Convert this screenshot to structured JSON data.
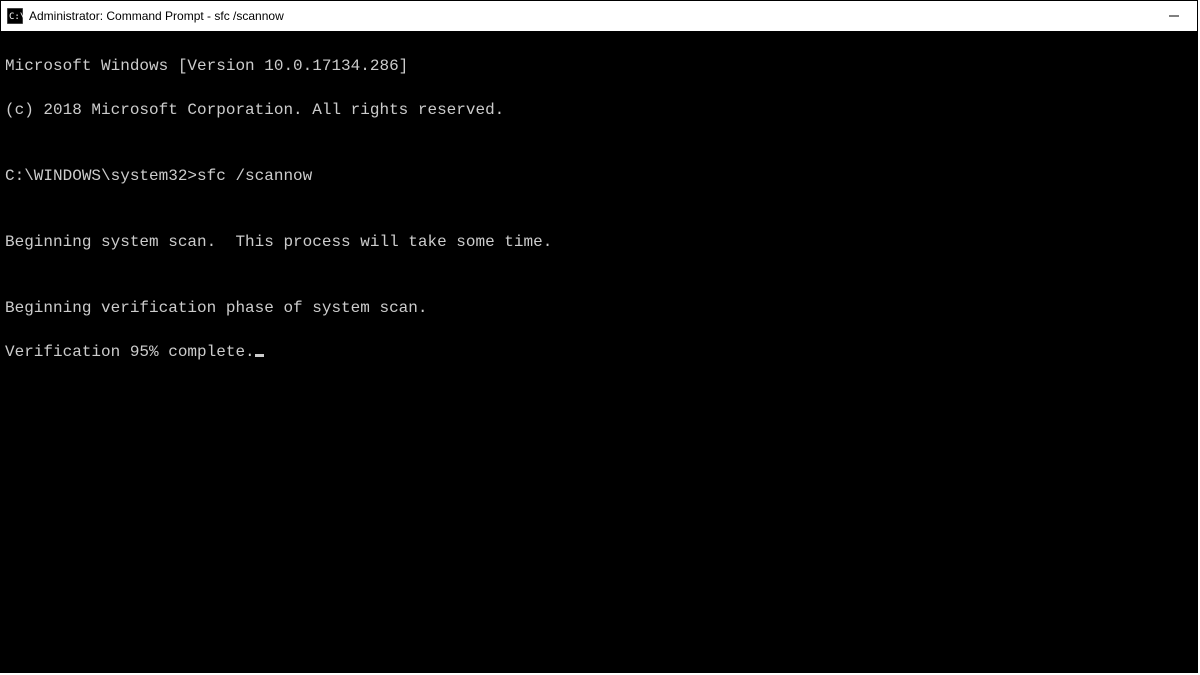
{
  "window": {
    "title": "Administrator: Command Prompt - sfc  /scannow"
  },
  "terminal": {
    "line1": "Microsoft Windows [Version 10.0.17134.286]",
    "line2": "(c) 2018 Microsoft Corporation. All rights reserved.",
    "blank1": "",
    "prompt_line": "C:\\WINDOWS\\system32>sfc /scannow",
    "blank2": "",
    "scan_line": "Beginning system scan.  This process will take some time.",
    "blank3": "",
    "verify_line": "Beginning verification phase of system scan.",
    "progress_line": "Verification 95% complete."
  }
}
